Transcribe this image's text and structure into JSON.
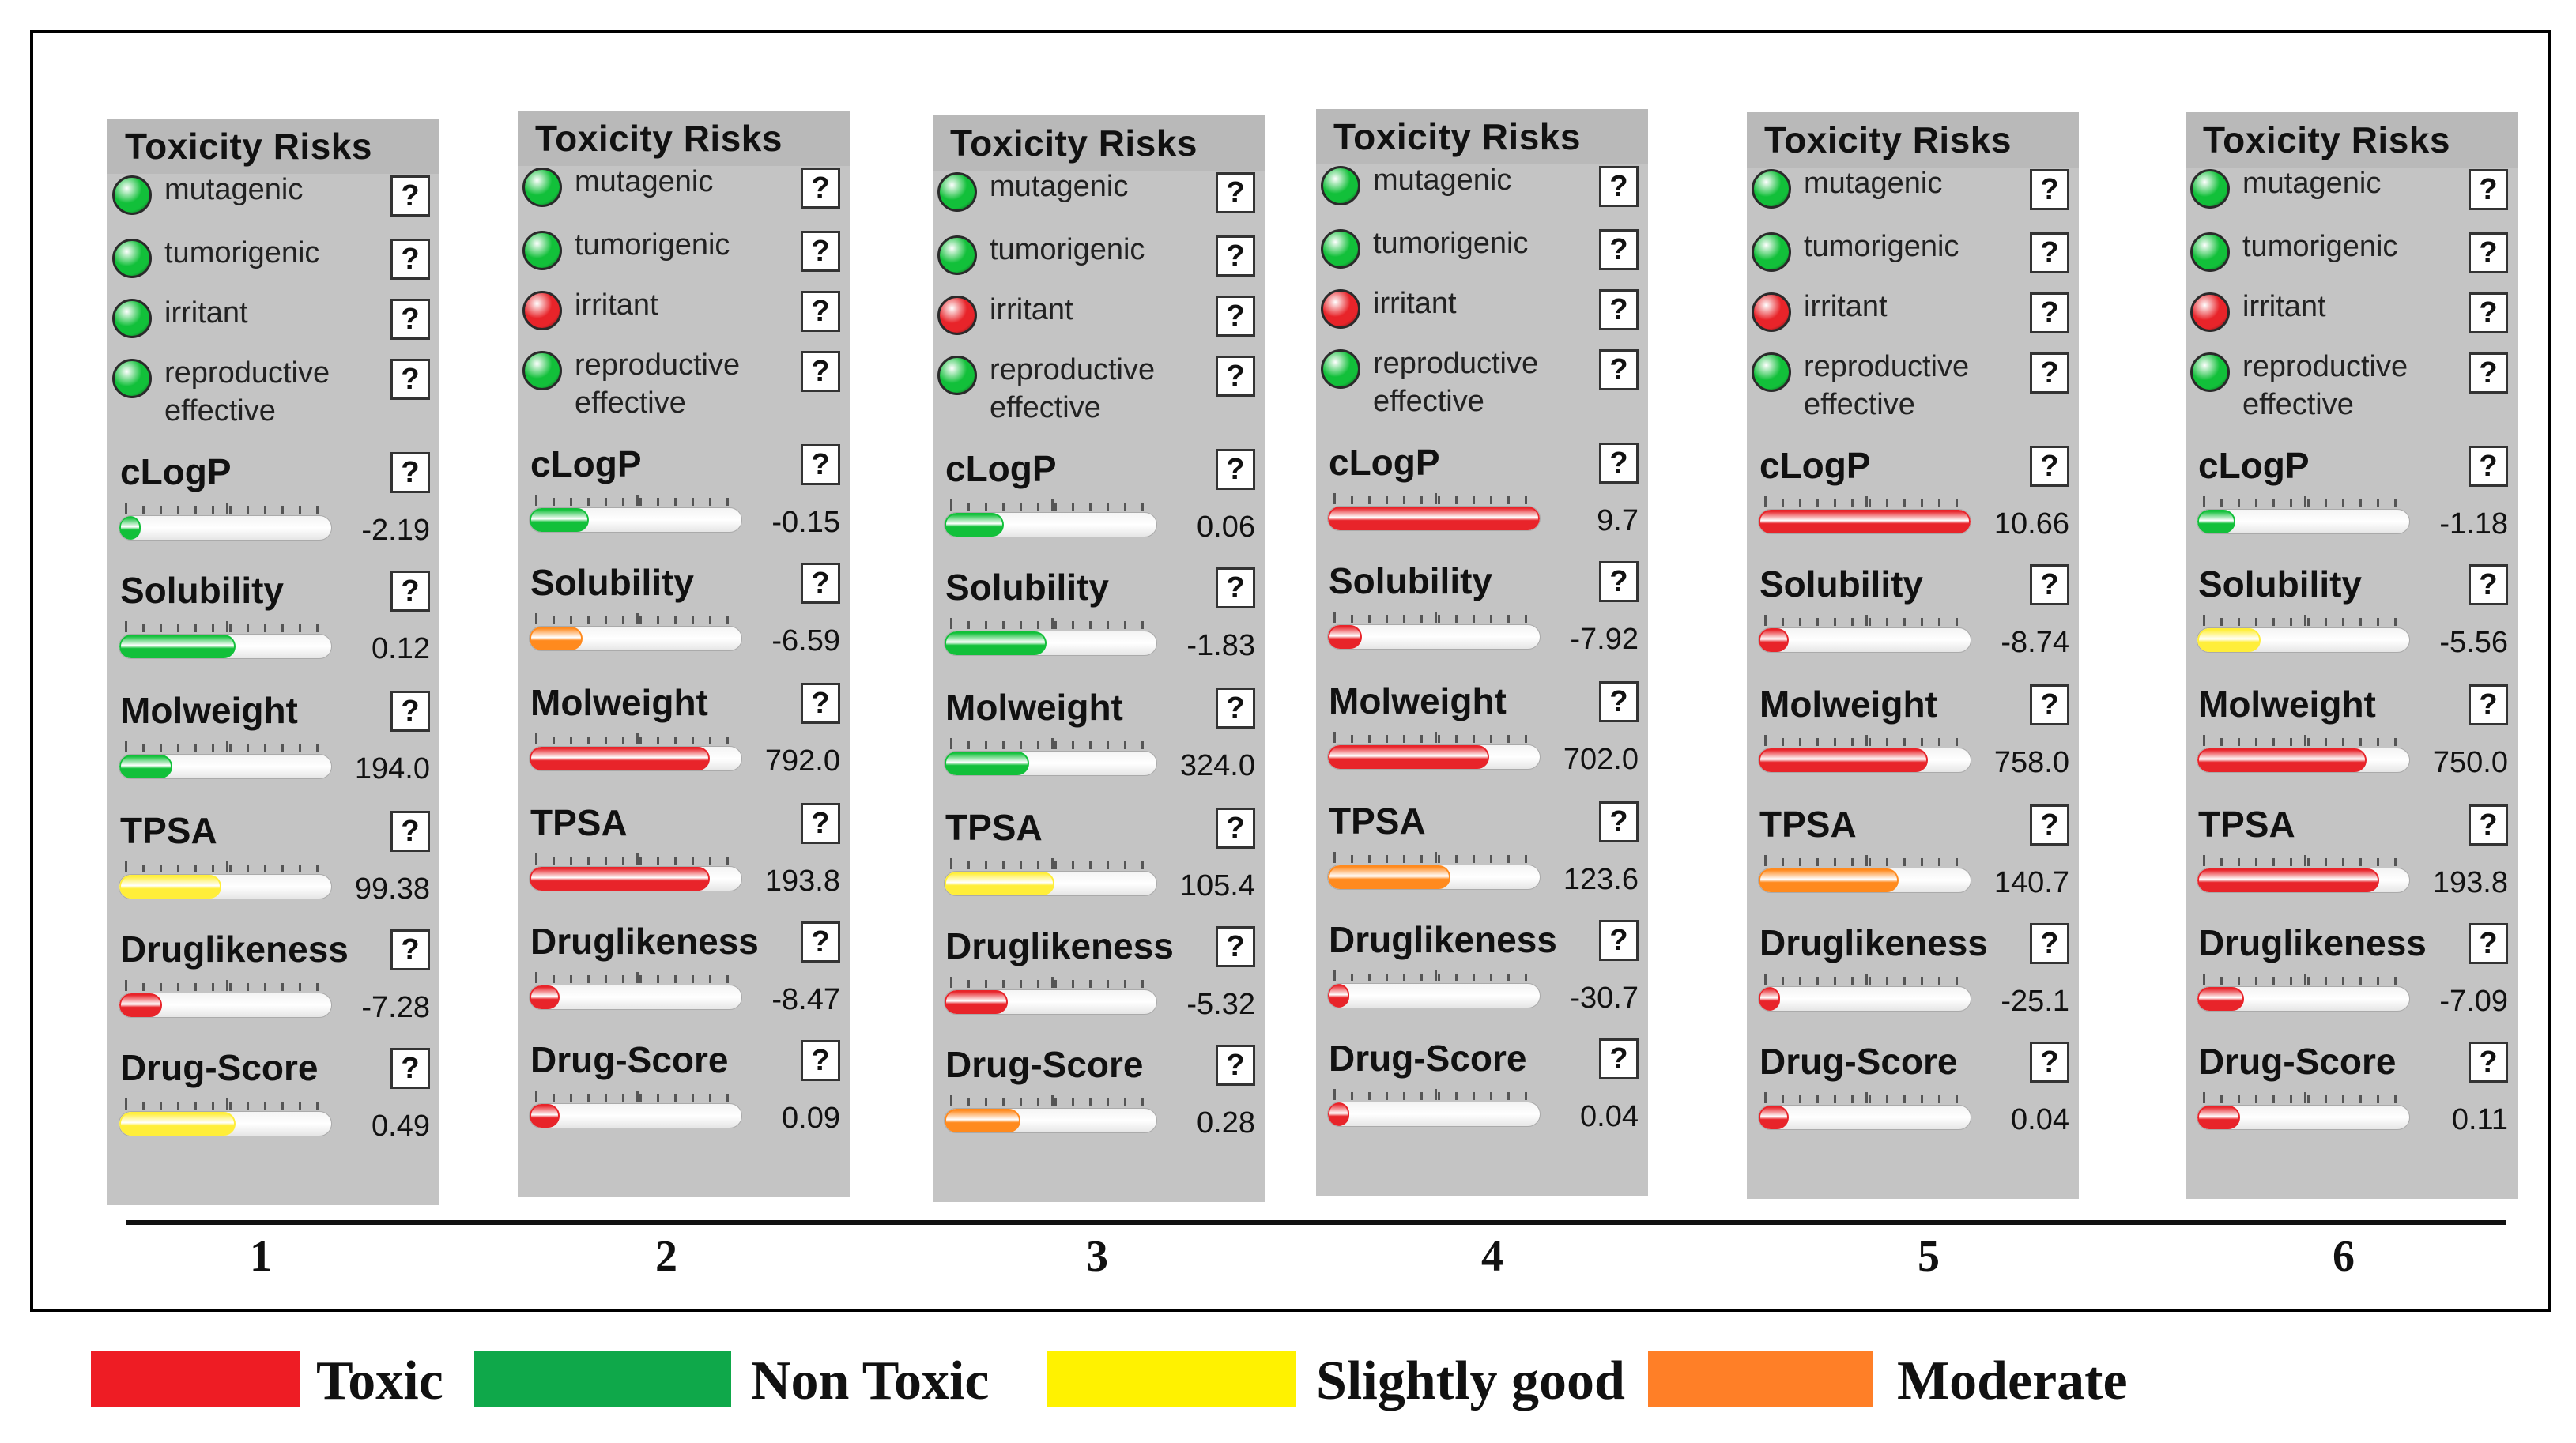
{
  "colors": {
    "non_toxic": "#12c03a",
    "toxic": "#e8242a",
    "moderate": "#ff8a1e",
    "slightly_good": "#ffee3a"
  },
  "panel_title": "Toxicity Risks",
  "risk_labels": [
    "mutagenic",
    "tumorigenic",
    "irritant",
    "reproductive effective"
  ],
  "help_glyph": "?",
  "property_names": [
    "cLogP",
    "Solubility",
    "Molweight",
    "TPSA",
    "Druglikeness",
    "Drug-Score"
  ],
  "panels": [
    {
      "number": "1",
      "risks": [
        "non_toxic",
        "non_toxic",
        "non_toxic",
        "non_toxic"
      ],
      "properties": [
        {
          "value": "-2.19",
          "level": 0.05,
          "rating": "non_toxic"
        },
        {
          "value": "0.12",
          "level": 0.55,
          "rating": "non_toxic"
        },
        {
          "value": "194.0",
          "level": 0.25,
          "rating": "non_toxic"
        },
        {
          "value": "99.38",
          "level": 0.48,
          "rating": "slightly_good"
        },
        {
          "value": "-7.28",
          "level": 0.2,
          "rating": "toxic"
        },
        {
          "value": "0.49",
          "level": 0.55,
          "rating": "slightly_good"
        }
      ]
    },
    {
      "number": "2",
      "risks": [
        "non_toxic",
        "non_toxic",
        "toxic",
        "non_toxic"
      ],
      "properties": [
        {
          "value": "-0.15",
          "level": 0.28,
          "rating": "non_toxic"
        },
        {
          "value": "-6.59",
          "level": 0.25,
          "rating": "moderate"
        },
        {
          "value": "792.0",
          "level": 0.85,
          "rating": "toxic"
        },
        {
          "value": "193.8",
          "level": 0.85,
          "rating": "toxic"
        },
        {
          "value": "-8.47",
          "level": 0.14,
          "rating": "toxic"
        },
        {
          "value": "0.09",
          "level": 0.14,
          "rating": "toxic"
        }
      ]
    },
    {
      "number": "3",
      "risks": [
        "non_toxic",
        "non_toxic",
        "toxic",
        "non_toxic"
      ],
      "properties": [
        {
          "value": "0.06",
          "level": 0.28,
          "rating": "non_toxic"
        },
        {
          "value": "-1.83",
          "level": 0.48,
          "rating": "non_toxic"
        },
        {
          "value": "324.0",
          "level": 0.4,
          "rating": "non_toxic"
        },
        {
          "value": "105.4",
          "level": 0.52,
          "rating": "slightly_good"
        },
        {
          "value": "-5.32",
          "level": 0.3,
          "rating": "toxic"
        },
        {
          "value": "0.28",
          "level": 0.36,
          "rating": "moderate"
        }
      ]
    },
    {
      "number": "4",
      "risks": [
        "non_toxic",
        "non_toxic",
        "toxic",
        "non_toxic"
      ],
      "properties": [
        {
          "value": "9.7",
          "level": 1.0,
          "rating": "toxic"
        },
        {
          "value": "-7.92",
          "level": 0.16,
          "rating": "toxic"
        },
        {
          "value": "702.0",
          "level": 0.76,
          "rating": "toxic"
        },
        {
          "value": "123.6",
          "level": 0.58,
          "rating": "moderate"
        },
        {
          "value": "-30.7",
          "level": 0.08,
          "rating": "toxic"
        },
        {
          "value": "0.04",
          "level": 0.1,
          "rating": "toxic"
        }
      ]
    },
    {
      "number": "5",
      "risks": [
        "non_toxic",
        "non_toxic",
        "toxic",
        "non_toxic"
      ],
      "properties": [
        {
          "value": "10.66",
          "level": 1.0,
          "rating": "toxic"
        },
        {
          "value": "-8.74",
          "level": 0.14,
          "rating": "toxic"
        },
        {
          "value": "758.0",
          "level": 0.8,
          "rating": "toxic"
        },
        {
          "value": "140.7",
          "level": 0.66,
          "rating": "moderate"
        },
        {
          "value": "-25.1",
          "level": 0.1,
          "rating": "toxic"
        },
        {
          "value": "0.04",
          "level": 0.14,
          "rating": "toxic"
        }
      ]
    },
    {
      "number": "6",
      "risks": [
        "non_toxic",
        "non_toxic",
        "toxic",
        "non_toxic"
      ],
      "properties": [
        {
          "value": "-1.18",
          "level": 0.18,
          "rating": "non_toxic"
        },
        {
          "value": "-5.56",
          "level": 0.3,
          "rating": "slightly_good"
        },
        {
          "value": "750.0",
          "level": 0.8,
          "rating": "toxic"
        },
        {
          "value": "193.8",
          "level": 0.86,
          "rating": "toxic"
        },
        {
          "value": "-7.09",
          "level": 0.22,
          "rating": "toxic"
        },
        {
          "value": "0.11",
          "level": 0.2,
          "rating": "toxic"
        }
      ]
    }
  ],
  "legend": [
    {
      "label": "Toxic",
      "color": "#ee1c24"
    },
    {
      "label": "Non Toxic",
      "color": "#0fa84a"
    },
    {
      "label": "Slightly good",
      "color": "#fff200"
    },
    {
      "label": "Moderate",
      "color": "#ff7f27"
    }
  ]
}
